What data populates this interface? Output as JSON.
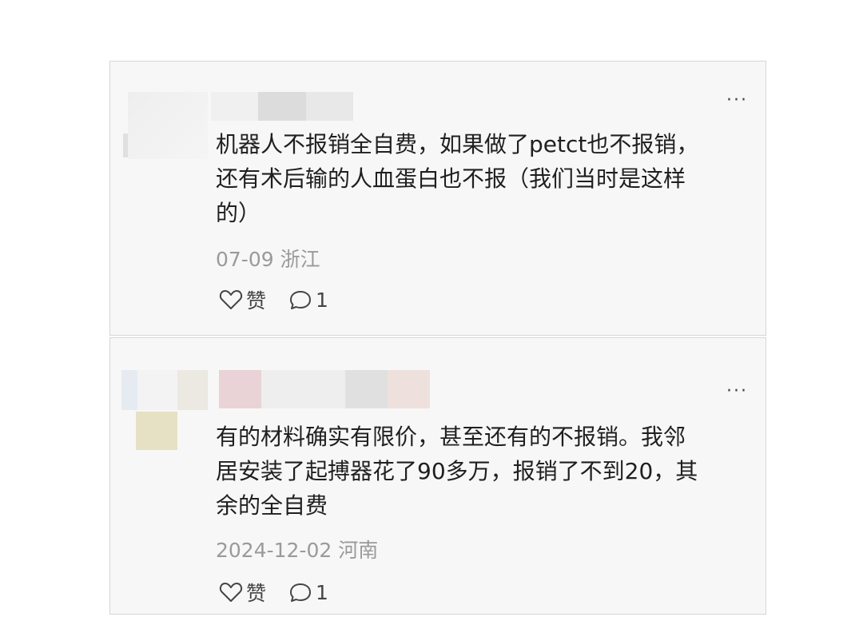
{
  "comments": [
    {
      "text": "机器人不报销全自费，如果做了petct也不报销，\n还有术后输的人血蛋白也不报（我们当时是这样\n的）",
      "date": "07-09",
      "location": "浙江",
      "like_label": "赞",
      "reply_count": "1",
      "more_label": "···"
    },
    {
      "text": "有的材料确实有限价，甚至还有的不报销。我邻\n居安装了起搏器花了90多万，报销了不到20，其\n余的全自费",
      "date": "2024-12-02",
      "location": "河南",
      "like_label": "赞",
      "reply_count": "1",
      "more_label": "···"
    }
  ],
  "icons": {
    "like": "heart-outline-icon",
    "reply": "speech-bubble-icon",
    "more": "more-dots-icon"
  },
  "colors": {
    "card_background": "#f7f7f7",
    "card_border": "#d6d6d6",
    "meta_text": "#9a9a9a"
  }
}
